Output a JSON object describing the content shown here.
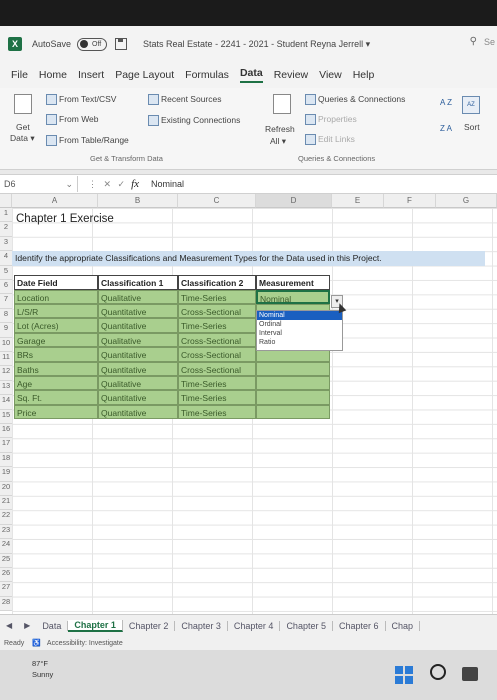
{
  "titlebar": {
    "autosave_label": "AutoSave",
    "autosave_state": "Off",
    "document_title": "Stats Real Estate - 2241 - 2021 - Student Reyna Jerrell",
    "title_caret": "▾",
    "search_hint": "Se"
  },
  "menu": {
    "items": [
      "File",
      "Home",
      "Insert",
      "Page Layout",
      "Formulas",
      "Data",
      "Review",
      "View",
      "Help"
    ],
    "active": "Data"
  },
  "ribbon": {
    "get_data": "Get",
    "get_data2": "Data ▾",
    "from_text_csv": "From Text/CSV",
    "from_web": "From Web",
    "from_table_range": "From Table/Range",
    "recent_sources": "Recent Sources",
    "existing_connections": "Existing Connections",
    "group_get_transform": "Get & Transform Data",
    "refresh_all": "Refresh",
    "refresh_all2": "All ▾",
    "queries_connections": "Queries & Connections",
    "properties": "Properties",
    "edit_links": "Edit Links",
    "group_queries": "Queries & Connections",
    "sort": "Sort",
    "sort_az": "A Z",
    "sort_za": "Z A"
  },
  "formula_bar": {
    "name_box": "D6",
    "fx_label": "fx",
    "value": "Nominal"
  },
  "columns": [
    "A",
    "B",
    "C",
    "D",
    "E",
    "F",
    "G"
  ],
  "rows": [
    "1",
    "2",
    "3",
    "4",
    "5",
    "6",
    "7",
    "8",
    "9",
    "10",
    "11",
    "12",
    "13",
    "14",
    "15",
    "16",
    "17",
    "18",
    "19",
    "20",
    "21",
    "22",
    "23",
    "24",
    "25",
    "26",
    "27",
    "28"
  ],
  "sheet": {
    "title": "Chapter 1 Exercise",
    "instruction": "Identify the appropriate Classifications and Measurement Types for the Data used in this Project.",
    "headers": [
      "Date Field",
      "Classification 1",
      "Classification 2",
      "Measurement"
    ],
    "table": [
      [
        "Location",
        "Qualitative",
        "Time-Series",
        "Nominal"
      ],
      [
        "L/S/R",
        "Quantitative",
        "Cross-Sectional",
        ""
      ],
      [
        "Lot (Acres)",
        "Quantitative",
        "Time-Series",
        ""
      ],
      [
        "Garage",
        "Qualitative",
        "Cross-Sectional",
        ""
      ],
      [
        "BRs",
        "Quantitative",
        "Cross-Sectional",
        ""
      ],
      [
        "Baths",
        "Quantitative",
        "Cross-Sectional",
        ""
      ],
      [
        "Age",
        "Qualitative",
        "Time-Series",
        ""
      ],
      [
        "Sq. Ft.",
        "Quantitative",
        "Time-Series",
        ""
      ],
      [
        "Price",
        "Quantitative",
        "Time-Series",
        ""
      ]
    ]
  },
  "dropdown": {
    "options": [
      "Nominal",
      "Ordinal",
      "Interval",
      "Ratio"
    ],
    "selected": "Nominal",
    "arrow": "▾"
  },
  "sheet_tabs": {
    "nav_prev": "◀",
    "nav_next": "▶",
    "tabs": [
      "Data",
      "Chapter 1",
      "Chapter 2",
      "Chapter 3",
      "Chapter 4",
      "Chapter 5",
      "Chapter 6",
      "Chap"
    ],
    "active": "Chapter 1"
  },
  "status": {
    "ready": "Ready",
    "accessibility": "Accessibility: Investigate"
  },
  "taskbar": {
    "temperature": "87°F",
    "condition": "Sunny"
  },
  "colors": {
    "excel_green": "#1e7145",
    "table_green": "#a9cf8e",
    "instruction_blue": "#cfe0f1",
    "dropdown_selected": "#1a5fc0"
  }
}
